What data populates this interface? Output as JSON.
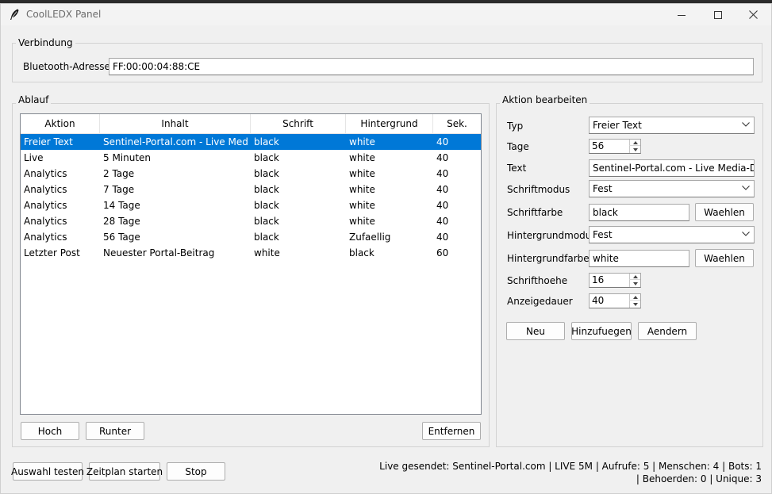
{
  "window": {
    "title": "CoolLEDX Panel",
    "icon": "feather-icon",
    "controls": [
      "minimize-icon",
      "maximize-icon",
      "close-icon"
    ]
  },
  "verbindung": {
    "frame_label": "Verbindung",
    "address_label": "Bluetooth-Adresse",
    "address_value": "FF:00:00:04:88:CE"
  },
  "ablauf": {
    "frame_label": "Ablauf",
    "columns": [
      "Aktion",
      "Inhalt",
      "Schrift",
      "Hintergrund",
      "Sek."
    ],
    "rows": [
      {
        "aktion": "Freier Text",
        "inhalt": "Sentinel-Portal.com - Live Media-Date",
        "schrift": "black",
        "hintergrund": "white",
        "sek": "40",
        "selected": true
      },
      {
        "aktion": "Live",
        "inhalt": "5 Minuten",
        "schrift": "black",
        "hintergrund": "white",
        "sek": "40"
      },
      {
        "aktion": "Analytics",
        "inhalt": "2 Tage",
        "schrift": "black",
        "hintergrund": "white",
        "sek": "40"
      },
      {
        "aktion": "Analytics",
        "inhalt": "7 Tage",
        "schrift": "black",
        "hintergrund": "white",
        "sek": "40"
      },
      {
        "aktion": "Analytics",
        "inhalt": "14 Tage",
        "schrift": "black",
        "hintergrund": "white",
        "sek": "40"
      },
      {
        "aktion": "Analytics",
        "inhalt": "28 Tage",
        "schrift": "black",
        "hintergrund": "white",
        "sek": "40"
      },
      {
        "aktion": "Analytics",
        "inhalt": "56 Tage",
        "schrift": "black",
        "hintergrund": "Zufaellig",
        "sek": "40"
      },
      {
        "aktion": "Letzter Post",
        "inhalt": "Neuester Portal-Beitrag",
        "schrift": "white",
        "hintergrund": "black",
        "sek": "60"
      }
    ],
    "buttons": {
      "hoch": "Hoch",
      "runter": "Runter",
      "entfernen": "Entfernen"
    }
  },
  "editor": {
    "frame_label": "Aktion bearbeiten",
    "typ_label": "Typ",
    "typ_value": "Freier Text",
    "tage_label": "Tage",
    "tage_value": "56",
    "text_label": "Text",
    "text_value": "Sentinel-Portal.com - Live Media-Date",
    "schriftmodus_label": "Schriftmodus",
    "schriftmodus_value": "Fest",
    "schriftfarbe_label": "Schriftfarbe",
    "schriftfarbe_value": "black",
    "hintergrundmodus_label": "Hintergrundmodus",
    "hintergrundmodus_value": "Fest",
    "hintergrundfarbe_label": "Hintergrundfarbe",
    "hintergrundfarbe_value": "white",
    "waehlen_label": "Waehlen",
    "schrifthoehe_label": "Schrifthoehe",
    "schrifthoehe_value": "16",
    "anzeigedauer_label": "Anzeigedauer",
    "anzeigedauer_value": "40",
    "neu_label": "Neu",
    "hinzufuegen_label": "Hinzufuegen",
    "aendern_label": "Aendern"
  },
  "footer": {
    "auswahl_testen": "Auswahl testen",
    "zeitplan_starten": "Zeitplan starten",
    "stop": "Stop",
    "status_line1": "Live gesendet: Sentinel-Portal.com | LIVE 5M | Aufrufe: 5 | Menschen: 4 | Bots: 1",
    "status_line2": "| Behoerden: 0 | Unique: 3"
  },
  "colors": {
    "selection": "#0078d7",
    "window_bg": "#f0f0f0"
  }
}
